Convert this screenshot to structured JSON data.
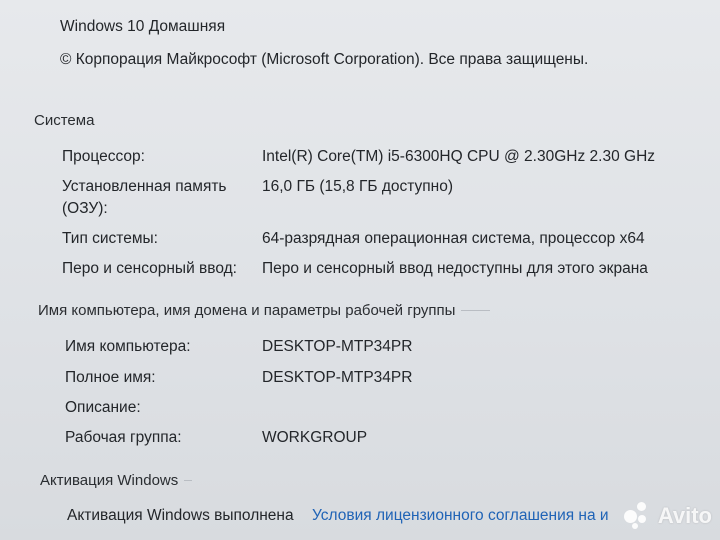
{
  "header": {
    "edition": "Windows 10 Домашняя",
    "copyright": "© Корпорация Майкрософт (Microsoft Corporation). Все права защищены."
  },
  "system": {
    "heading": "Система",
    "rows": [
      {
        "label": "Процессор:",
        "value": "Intel(R) Core(TM) i5-6300HQ CPU @ 2.30GHz   2.30 GHz"
      },
      {
        "label": "Установленная память",
        "label2": "(ОЗУ):",
        "value": "16,0 ГБ (15,8 ГБ доступно)"
      },
      {
        "label": "Тип системы:",
        "value": "64-разрядная операционная система, процессор x64"
      },
      {
        "label": "Перо и сенсорный ввод:",
        "value": "Перо и сенсорный ввод недоступны для этого экрана"
      }
    ]
  },
  "computer": {
    "heading": "Имя компьютера, имя домена и параметры рабочей группы",
    "rows": [
      {
        "label": "Имя компьютера:",
        "value": "DESKTOP-MTP34PR"
      },
      {
        "label": "Полное имя:",
        "value": "DESKTOP-MTP34PR"
      },
      {
        "label": "Описание:",
        "value": ""
      },
      {
        "label": "Рабочая группа:",
        "value": "WORKGROUP"
      }
    ]
  },
  "activation": {
    "heading": "Активация Windows",
    "status": "Активация Windows выполнена",
    "license_link": "Условия лицензионного соглашения на и"
  },
  "watermark": {
    "text": "Avito"
  },
  "colors": {
    "link": "#1f63b6",
    "background": "#e2e5e8"
  }
}
